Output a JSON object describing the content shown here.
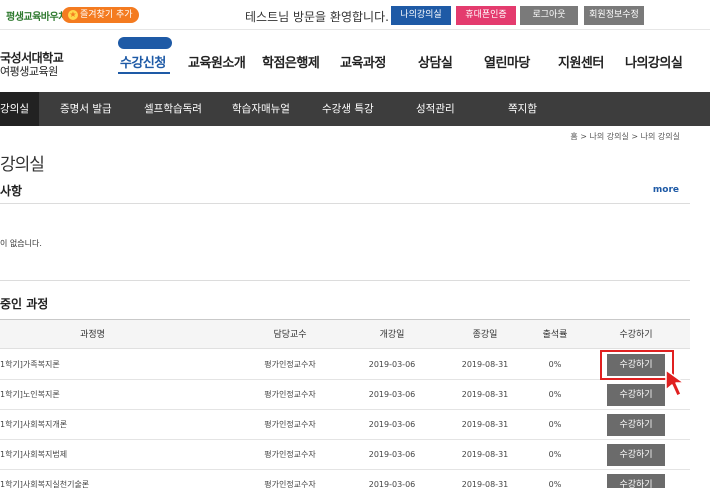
{
  "topbar": {
    "logo_text": "평생교육바우처",
    "favorite_label": "즐겨찾기 추가",
    "welcome": "테스트님 방문을 환영합니다.",
    "buttons": {
      "my_class": "나의강의실",
      "phone_auth": "휴대폰인증",
      "logout": "로그아웃",
      "member_edit": "회원정보수정"
    },
    "colors": {
      "my_class": "#1e5aa6",
      "phone_auth": "#e43b6e",
      "gray": "#7a7a7a",
      "favorite": "#f47b20"
    }
  },
  "header": {
    "univ_line1": "국성서대학교",
    "univ_line2": "여평생교육원",
    "gnb": [
      "수강신청",
      "교육원소개",
      "학점은행제",
      "교육과정",
      "상담실",
      "열린마당",
      "지원센터",
      "나의강의실"
    ],
    "active_index": 0
  },
  "subnav": {
    "items": [
      "강의실",
      "증명서 발급",
      "셀프학습독려",
      "학습자매뉴얼",
      "수강생 특강",
      "성적관리",
      "쪽지함"
    ],
    "active_index": 0
  },
  "breadcrumb": "홈 > 나의 강의실 > 나의 강의실",
  "page_title": "강의실",
  "notice": {
    "title": "사항",
    "more": "more",
    "empty": "이 없습니다."
  },
  "courses": {
    "title": "중인 과정",
    "columns": [
      "과정명",
      "담당교수",
      "개강일",
      "종강일",
      "출석률",
      "수강하기"
    ],
    "rows": [
      {
        "name": "1학기]가족복지론",
        "professor": "평가인정교수자",
        "start": "2019-03-06",
        "end": "2019-08-31",
        "attendance": "0%",
        "action": "수강하기"
      },
      {
        "name": "1학기]노인복지론",
        "professor": "평가인정교수자",
        "start": "2019-03-06",
        "end": "2019-08-31",
        "attendance": "0%",
        "action": "수강하기"
      },
      {
        "name": "1학기]사회복지개론",
        "professor": "평가인정교수자",
        "start": "2019-03-06",
        "end": "2019-08-31",
        "attendance": "0%",
        "action": "수강하기"
      },
      {
        "name": "1학기]사회복지법제",
        "professor": "평가인정교수자",
        "start": "2019-03-06",
        "end": "2019-08-31",
        "attendance": "0%",
        "action": "수강하기"
      },
      {
        "name": "1학기]사회복지실천기술론",
        "professor": "평가인정교수자",
        "start": "2019-03-06",
        "end": "2019-08-31",
        "attendance": "0%",
        "action": "수강하기"
      }
    ],
    "highlight_color": "#e02020"
  }
}
